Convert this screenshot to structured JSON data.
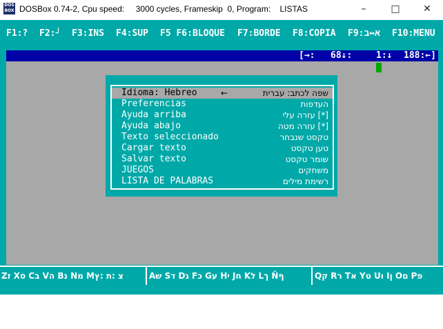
{
  "window": {
    "title": "DOSBox 0.74-2, Cpu speed:     3000 cycles, Frameskip  0, Program:    LISTAS",
    "icon_text": "DOS BOX",
    "minimize": "–",
    "maximize": "□",
    "close": "✕"
  },
  "menubar": [
    {
      "label": "F1:?"
    },
    {
      "label": "F2:┘"
    },
    {
      "label": "F3:INS"
    },
    {
      "label": "F4:SUP"
    },
    {
      "label": "F5 F6:BLOQUE"
    },
    {
      "label": "F7:BORDE"
    },
    {
      "label": "F8:COPIA"
    },
    {
      "label": "F9:א↔ב"
    },
    {
      "label": "F10:MENU"
    }
  ],
  "status": {
    "mode": "[→:",
    "col": "68↓:",
    "line": "1:↓",
    "count": "188:←]"
  },
  "dialog": {
    "items": [
      {
        "label": "Idioma: Hebreo",
        "hebrew": "שפה לכתב: עברית",
        "arrow": "←"
      },
      {
        "label": "Preferencias",
        "hebrew": "העדפות"
      },
      {
        "label": "Ayuda arriba",
        "hebrew": "[*] עזרה עלי"
      },
      {
        "label": "Ayuda abajo",
        "hebrew": "[*] עזרה מטה"
      },
      {
        "label": "Texto seleccionado",
        "hebrew": "טקסט שנבחר"
      },
      {
        "label": "Cargar texto",
        "hebrew": "טען טקסט"
      },
      {
        "label": "Salvar texto",
        "hebrew": "שומר טקסט"
      },
      {
        "label": "JUEGOS",
        "hebrew": "משחקים"
      },
      {
        "label": "LISTA DE PALABRAS",
        "hebrew": "רשימת מילים"
      }
    ]
  },
  "keystrip": {
    "group1": "Zז Xס Cב Vה Bנ Nמ Mצ :ת :ץ",
    "group2": "Aש Sד Dג Fכ Gע Hי Jח Kל Lך Ñף",
    "group3": "Qק Rר Tא Yט Uו Iן Oם Pפ"
  }
}
